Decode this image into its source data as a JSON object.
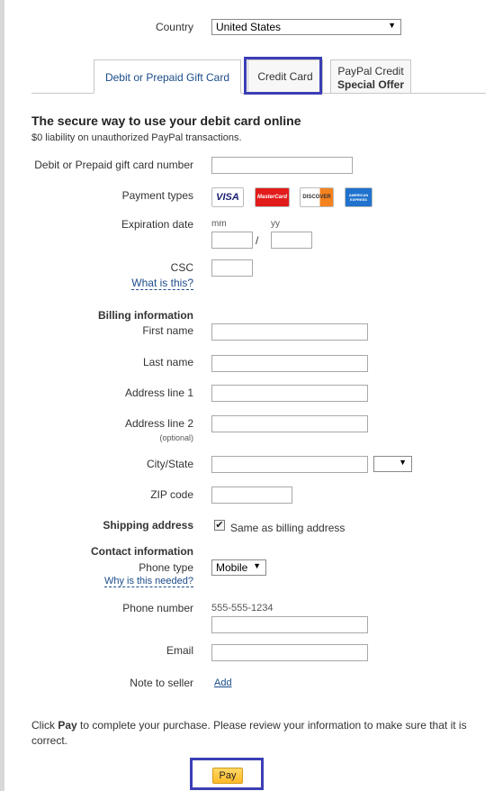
{
  "country": {
    "label": "Country",
    "value": "United States"
  },
  "tabs": [
    {
      "label": "Debit or Prepaid Gift Card"
    },
    {
      "label": "Credit Card"
    },
    {
      "line1": "PayPal Credit",
      "line2": "Special Offer"
    }
  ],
  "form": {
    "heading": "The secure way to use your debit card online",
    "subheading": "$0 liability on unauthorized PayPal transactions.",
    "card_number_label": "Debit or Prepaid gift card number",
    "payment_types_label": "Payment types",
    "payment_types": [
      "VISA",
      "MasterCard",
      "DISCOVER",
      "AMERICAN EXPRESS"
    ],
    "expiration_label": "Expiration date",
    "exp_mm": "mm",
    "exp_yy": "yy",
    "exp_sep": "/",
    "csc_label": "CSC",
    "csc_help": "What is this?",
    "billing_heading": "Billing information",
    "first_name_label": "First name",
    "last_name_label": "Last name",
    "address1_label": "Address line 1",
    "address2_label": "Address line 2",
    "address2_hint": "(optional)",
    "city_state_label": "City/State",
    "zip_label": "ZIP code",
    "shipping_label": "Shipping address",
    "same_as_billing": "Same as billing address",
    "contact_heading": "Contact information",
    "phone_type_label": "Phone type",
    "phone_type_value": "Mobile",
    "phone_help": "Why is this needed?",
    "phone_number_label": "Phone number",
    "phone_placeholder": "555-555-1234",
    "email_label": "Email",
    "note_label": "Note to seller",
    "note_add": "Add",
    "footer_pre": "Click ",
    "footer_bold": "Pay",
    "footer_post": " to complete your purchase. Please review your information to make sure that it is correct.",
    "pay_button": "Pay"
  },
  "colors": {
    "highlight": "#3c3fb5",
    "link": "#1b4c8a",
    "pay_button": "#ffc439"
  }
}
